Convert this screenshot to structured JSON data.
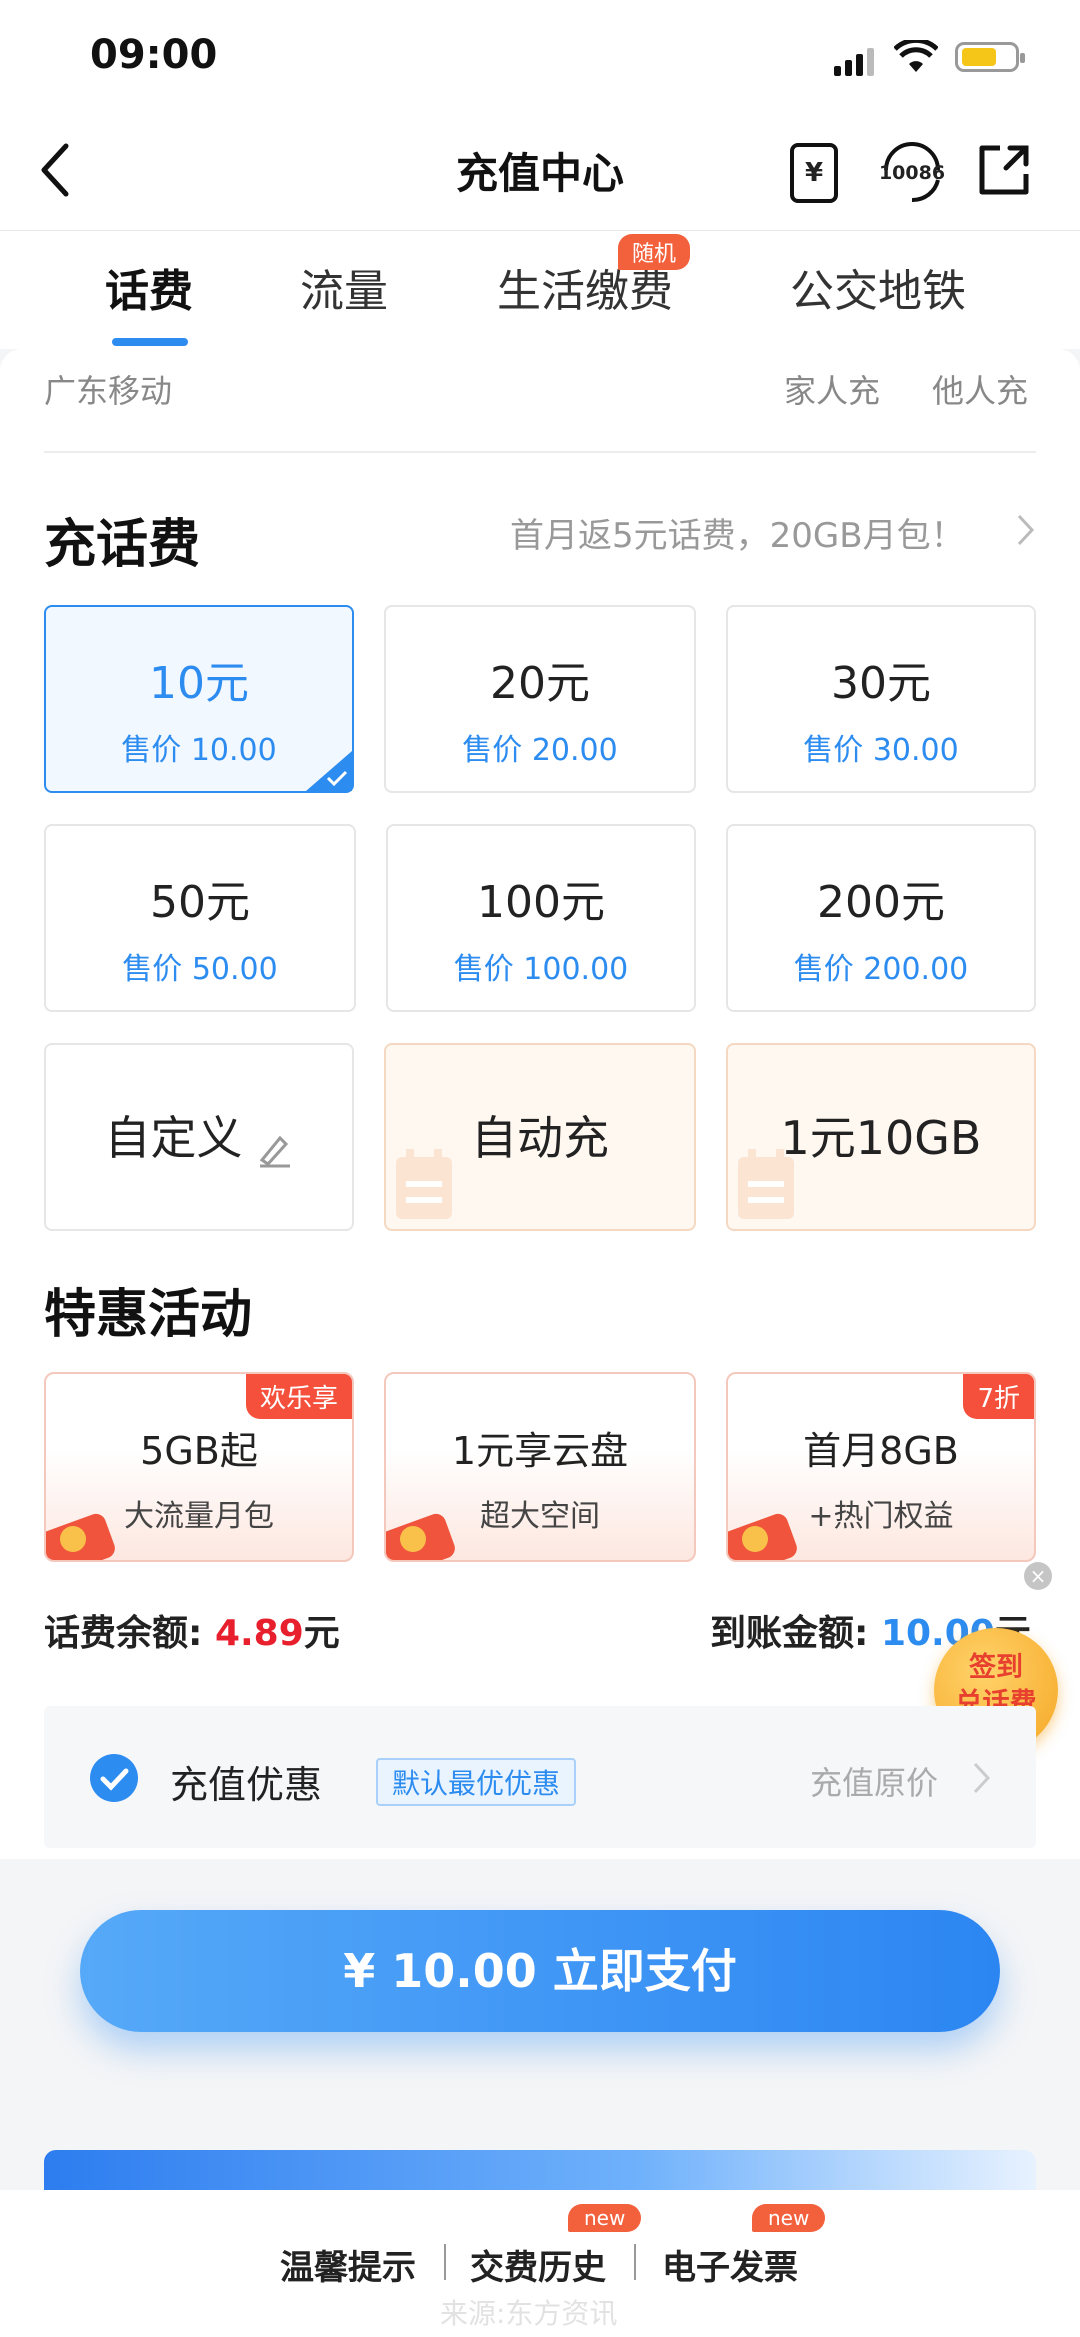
{
  "status_bar": {
    "time": "09:00"
  },
  "nav": {
    "title": "充值中心",
    "phone_icon_text": "¥",
    "service_icon_text": "10086"
  },
  "tabs": [
    {
      "label": "话费",
      "active": true
    },
    {
      "label": "流量"
    },
    {
      "label": "生活缴费",
      "badge": "随机"
    },
    {
      "label": "公交地铁"
    }
  ],
  "carrier": {
    "name": "广东移动",
    "links": [
      "家人充",
      "他人充"
    ]
  },
  "recharge": {
    "title": "充话费",
    "promo_text": "首月返5元话费，20GB月包！",
    "amounts": [
      {
        "label": "10元",
        "price": "售价 10.00",
        "selected": true
      },
      {
        "label": "20元",
        "price": "售价 20.00"
      },
      {
        "label": "30元",
        "price": "售价 30.00"
      },
      {
        "label": "50元",
        "price": "售价 50.00"
      },
      {
        "label": "100元",
        "price": "售价 100.00"
      },
      {
        "label": "200元",
        "price": "售价 200.00"
      }
    ],
    "custom_label": "自定义",
    "auto_label": "自动充",
    "data_deal_label": "1元10GB"
  },
  "deals": {
    "title": "特惠活动",
    "items": [
      {
        "tag": "欢乐享",
        "line1": "5GB起",
        "line2": "大流量月包"
      },
      {
        "tag": "",
        "line1": "1元享云盘",
        "line2": "超大空间"
      },
      {
        "tag": "7折",
        "line1": "首月8GB",
        "line2": "+热门权益"
      }
    ]
  },
  "balance": {
    "label": "话费余额:",
    "value": "4.89",
    "unit": "元",
    "arrive_label": "到账金额:",
    "arrive_value": "10.00",
    "arrive_unit": "元"
  },
  "sign_in": {
    "line1": "签到",
    "line2": "兑话费"
  },
  "discount": {
    "label": "充值优惠",
    "badge": "默认最优优惠",
    "right": "充值原价"
  },
  "pay_button": "¥ 10.00  立即支付",
  "bottom_links": [
    {
      "label": "温馨提示"
    },
    {
      "label": "交费历史",
      "badge": "new"
    },
    {
      "label": "电子发票",
      "badge": "new"
    }
  ],
  "watermark": "来源:东方资讯"
}
